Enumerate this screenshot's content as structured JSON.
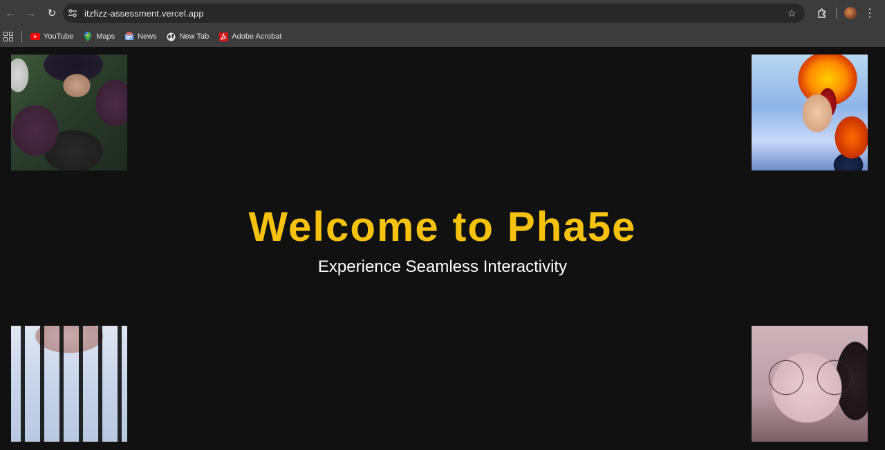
{
  "browser": {
    "url": "itzfizz-assessment.vercel.app",
    "bookmarks": [
      {
        "label": "YouTube",
        "icon": "youtube-icon"
      },
      {
        "label": "Maps",
        "icon": "maps-icon"
      },
      {
        "label": "News",
        "icon": "news-icon"
      },
      {
        "label": "New Tab",
        "icon": "globe-icon"
      },
      {
        "label": "Adobe Acrobat",
        "icon": "acrobat-icon"
      }
    ]
  },
  "hero": {
    "title": "Welcome to Pha5e",
    "subtitle": "Experience Seamless Interactivity"
  },
  "colors": {
    "page_background": "#111111",
    "title_accent": "#f6c20f",
    "subtitle_text": "#ffffff"
  }
}
